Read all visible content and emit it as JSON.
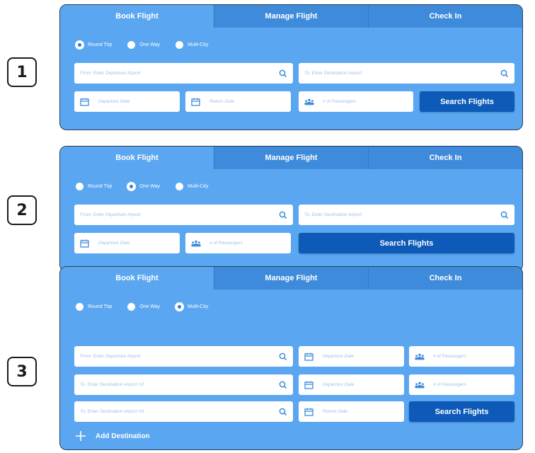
{
  "steps": [
    "1",
    "2",
    "3"
  ],
  "colors": {
    "panel": "#5aa6f0",
    "tab_inactive": "#3f8bdb",
    "button": "#0d5ab8",
    "placeholder": "#9fbfe8",
    "icon": "#3f8bdb"
  },
  "tabs": {
    "book": "Book Flight",
    "manage": "Manage Flight",
    "checkin": "Check In"
  },
  "trip_types": {
    "round_trip": "Round Trip",
    "one_way": "One Way",
    "multi_city": "Multi-City"
  },
  "selected_trip_type": {
    "panel1": "round_trip",
    "panel2": "one_way",
    "panel3": "multi_city"
  },
  "placeholders": {
    "from": "From: Enter Departure Airport",
    "to": "To: Enter Destination Airport",
    "to_2": "To: Enter Destination Airport #2",
    "to_3": "To: Enter Destination Airport #3",
    "departure_date": "Departure Date",
    "return_date": "Return Date",
    "passengers": "# of Passengers"
  },
  "search_button": "Search Flights",
  "add_destination": "Add Destination",
  "icons": {
    "search": "search-icon",
    "calendar": "calendar-icon",
    "passengers": "passengers-icon",
    "plus": "plus-icon"
  }
}
